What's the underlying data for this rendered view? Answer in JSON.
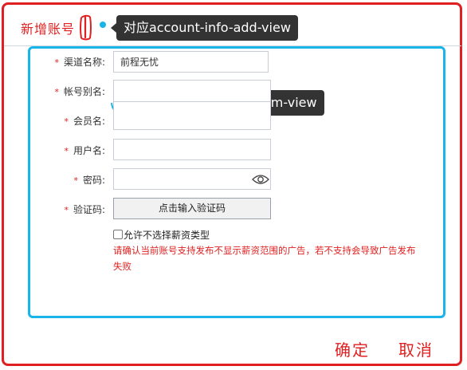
{
  "dialog": {
    "title": "新增账号",
    "confirm_label": "确定",
    "cancel_label": "取消"
  },
  "annotations": {
    "tag1": "对应account-info-add-view",
    "tag2": "对应channel-form-view",
    "color_outer": "#e02020",
    "color_inner": "#19b5e8"
  },
  "form": {
    "channel_name": {
      "label": "渠道名称:",
      "value": "前程无忧"
    },
    "account_alias": {
      "label": "帐号别名:",
      "value": ""
    },
    "member_name": {
      "label": "会员名:",
      "value": ""
    },
    "username": {
      "label": "用户名:",
      "value": ""
    },
    "password": {
      "label": "密码:",
      "value": ""
    },
    "captcha": {
      "label": "验证码:",
      "button_label": "点击输入验证码"
    },
    "allow_no_salary_type": {
      "label": "允许不选择薪资类型",
      "checked": false
    },
    "warning": "请确认当前账号支持发布不显示薪资范围的广告，若不支持会导致广告发布失败",
    "required_mark": "*"
  }
}
